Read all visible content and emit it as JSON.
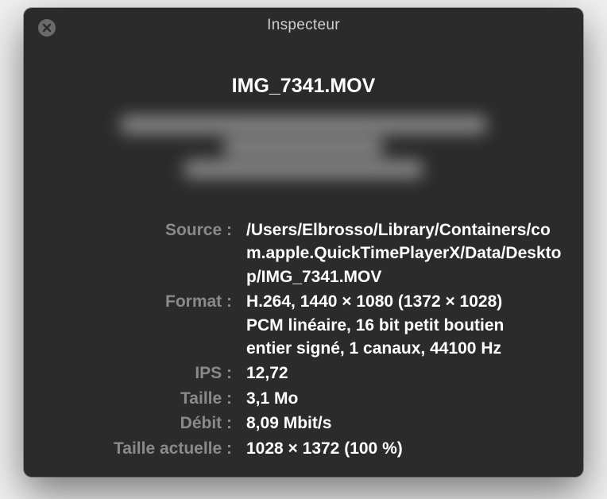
{
  "window": {
    "title": "Inspecteur"
  },
  "file": {
    "name": "IMG_7341.MOV"
  },
  "labels": {
    "source": "Source :",
    "format": "Format :",
    "fps": "IPS :",
    "size": "Taille :",
    "bitrate": "Débit :",
    "currentSize": "Taille actuelle :"
  },
  "values": {
    "source": "/Users/Elbrosso/Library/Containers/com.apple.QuickTimePlayerX/Data/Desktop/IMG_7341.MOV",
    "format": "H.264, 1440 × 1080 (1372 × 1028) PCM linéaire, 16 bit petit boutien entier signé, 1 canaux, 44100 Hz",
    "fps": "12,72",
    "size": "3,1 Mo",
    "bitrate": "8,09 Mbit/s",
    "currentSize": "1028 × 1372 (100 %)"
  }
}
